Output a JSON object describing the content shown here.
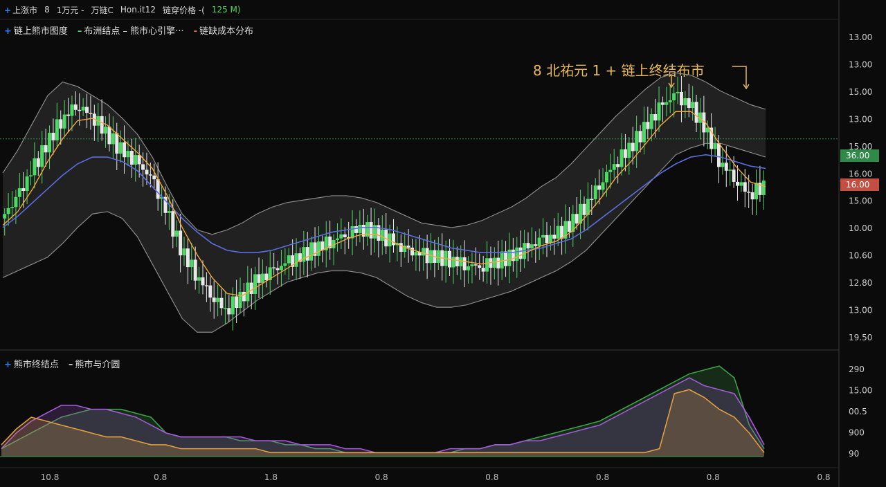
{
  "header": {
    "title": "上涨市",
    "segments": [
      "8",
      "1万元 -",
      "万链C",
      "Hon.it12",
      "链穿价格 -("
    ],
    "extra": "125 M)"
  },
  "legend_main": [
    {
      "label": "链上熊市图度",
      "color": "#2e7cf6",
      "symbol": "+"
    },
    {
      "label": "布洲结点 – 熊市心引擎···",
      "color": "#4cd964",
      "symbol": "–"
    },
    {
      "label": "链缺成本分布",
      "color": "#e36b5b",
      "symbol": "-"
    }
  ],
  "legend_sub": [
    {
      "label": "熊市终结点",
      "color": "#2e7cf6",
      "symbol": "+"
    },
    {
      "label": "熊市与介圆",
      "color": "#dcdcdc",
      "symbol": "–"
    }
  ],
  "annotation": "8 北祐元 1 + 链上终结布市",
  "colors": {
    "up": "#4cd964",
    "down": "#e8e8e8",
    "ma_fast": "#f2a93b",
    "ma_slow": "#5b6ee0",
    "band": "#5a5a5a",
    "hline": "#2f8f4e",
    "tag_green": "#2f8a4a",
    "tag_red": "#c24f42",
    "area_green": "#3fa04a",
    "area_purple": "#a35ad8",
    "area_orange": "#e0a040"
  },
  "chart_data": [
    {
      "type": "candlestick",
      "y_tick_labels": [
        "13.00",
        "13.00",
        "15.00",
        "13.00",
        "15.00",
        "16.00",
        "15.00",
        "10.00",
        "10.60",
        "12.80",
        "13.00",
        "19.50"
      ],
      "x_tick_labels": [
        "10.8",
        "0.8",
        "1.8",
        "0.8",
        "0.8",
        "0.8",
        "0.8",
        "0.8"
      ],
      "price_tags": [
        {
          "label": "36.00",
          "color": "green"
        },
        {
          "label": "16.00",
          "color": "red"
        }
      ],
      "close": [
        9.6,
        10.4,
        11.6,
        12.8,
        13.9,
        14.6,
        14.2,
        13.4,
        12.6,
        12.1,
        11.4,
        10.0,
        8.3,
        7.2,
        6.3,
        5.6,
        6.1,
        6.8,
        7.2,
        7.6,
        7.9,
        8.3,
        8.6,
        8.9,
        9.2,
        9.0,
        8.6,
        8.2,
        8.0,
        7.9,
        7.8,
        7.6,
        7.5,
        7.7,
        7.9,
        8.2,
        8.6,
        8.8,
        9.3,
        10.1,
        11.1,
        12.0,
        12.7,
        13.5,
        14.4,
        15.0,
        14.6,
        13.7,
        12.2,
        11.4,
        10.7,
        11.0
      ],
      "ma_fast": [
        9.3,
        9.9,
        10.9,
        12.1,
        13.1,
        13.9,
        14.0,
        13.7,
        13.1,
        12.5,
        11.8,
        10.6,
        9.2,
        8.0,
        7.0,
        6.3,
        6.2,
        6.6,
        7.0,
        7.4,
        7.8,
        8.1,
        8.4,
        8.7,
        8.9,
        8.9,
        8.6,
        8.3,
        8.1,
        7.9,
        7.8,
        7.7,
        7.6,
        7.7,
        7.8,
        8.1,
        8.4,
        8.6,
        9.0,
        9.7,
        10.5,
        11.4,
        12.1,
        12.9,
        13.7,
        14.3,
        14.3,
        13.8,
        12.8,
        11.9,
        11.2,
        11.0
      ],
      "ma_slow": [
        9.2,
        9.7,
        10.3,
        10.9,
        11.5,
        12.0,
        12.3,
        12.3,
        12.1,
        11.7,
        11.0,
        10.3,
        9.6,
        9.0,
        8.5,
        8.2,
        8.1,
        8.1,
        8.2,
        8.4,
        8.6,
        8.8,
        9.0,
        9.1,
        9.2,
        9.2,
        9.1,
        8.9,
        8.7,
        8.5,
        8.3,
        8.2,
        8.1,
        8.1,
        8.1,
        8.2,
        8.3,
        8.5,
        8.7,
        9.1,
        9.6,
        10.1,
        10.6,
        11.1,
        11.6,
        12.0,
        12.3,
        12.4,
        12.3,
        12.1,
        11.9,
        11.8
      ],
      "band_upper": [
        11.6,
        12.6,
        13.8,
        15.0,
        15.6,
        15.4,
        15.0,
        14.6,
        14.0,
        13.3,
        12.3,
        11.0,
        9.8,
        9.1,
        8.9,
        9.1,
        9.4,
        9.8,
        10.1,
        10.3,
        10.4,
        10.5,
        10.6,
        10.6,
        10.5,
        10.3,
        10.0,
        9.7,
        9.4,
        9.3,
        9.2,
        9.3,
        9.5,
        9.8,
        10.1,
        10.5,
        11.0,
        11.4,
        12.0,
        12.7,
        13.4,
        14.1,
        14.7,
        15.3,
        15.8,
        16.0,
        15.9,
        15.6,
        15.2,
        14.9,
        14.6,
        14.4
      ],
      "band_lower": [
        7.0,
        7.3,
        7.6,
        7.9,
        8.5,
        9.2,
        9.8,
        9.9,
        9.6,
        8.8,
        7.6,
        6.4,
        5.2,
        4.6,
        4.6,
        5.0,
        5.5,
        6.0,
        6.4,
        6.8,
        7.0,
        7.2,
        7.3,
        7.3,
        7.2,
        7.0,
        6.6,
        6.2,
        5.9,
        5.7,
        5.7,
        5.8,
        6.0,
        6.2,
        6.4,
        6.7,
        7.0,
        7.3,
        7.7,
        8.2,
        8.9,
        9.6,
        10.3,
        11.0,
        11.7,
        12.4,
        12.7,
        12.9,
        12.9,
        12.7,
        12.5,
        12.3
      ],
      "hline_value": 13.1,
      "ylim": [
        4.0,
        17.5
      ]
    },
    {
      "type": "area",
      "y_tick_labels": [
        "290",
        "15.00",
        "00.5",
        "900",
        "90"
      ],
      "series": [
        {
          "values": [
            2,
            4,
            6,
            8,
            10,
            11,
            12,
            12,
            12,
            11,
            10,
            6,
            5,
            5,
            5,
            5,
            4,
            4,
            4,
            3,
            3,
            2,
            2,
            1,
            1,
            1,
            1,
            1,
            1,
            1,
            1,
            2,
            2,
            3,
            3,
            4,
            5,
            6,
            7,
            8,
            9,
            11,
            13,
            15,
            17,
            19,
            21,
            22,
            23,
            20,
            8,
            2
          ],
          "color": "green"
        },
        {
          "values": [
            2,
            6,
            9,
            11,
            13,
            13,
            12,
            12,
            11,
            10,
            8,
            6,
            5,
            5,
            5,
            5,
            5,
            4,
            4,
            4,
            3,
            3,
            3,
            2,
            2,
            1,
            1,
            1,
            1,
            1,
            2,
            2,
            2,
            3,
            3,
            4,
            4,
            5,
            6,
            7,
            8,
            10,
            12,
            14,
            16,
            18,
            20,
            18,
            17,
            16,
            10,
            3
          ],
          "color": "purple"
        },
        {
          "values": [
            3,
            7,
            10,
            9,
            8,
            7,
            6,
            5,
            5,
            4,
            3,
            3,
            2,
            2,
            2,
            2,
            2,
            2,
            1,
            1,
            1,
            1,
            1,
            1,
            1,
            1,
            1,
            1,
            1,
            1,
            1,
            1,
            1,
            1,
            1,
            1,
            1,
            1,
            1,
            1,
            1,
            1,
            1,
            1,
            2,
            16,
            17,
            15,
            12,
            10,
            6,
            1
          ],
          "color": "orange"
        }
      ],
      "ylim": [
        0,
        26
      ]
    }
  ]
}
